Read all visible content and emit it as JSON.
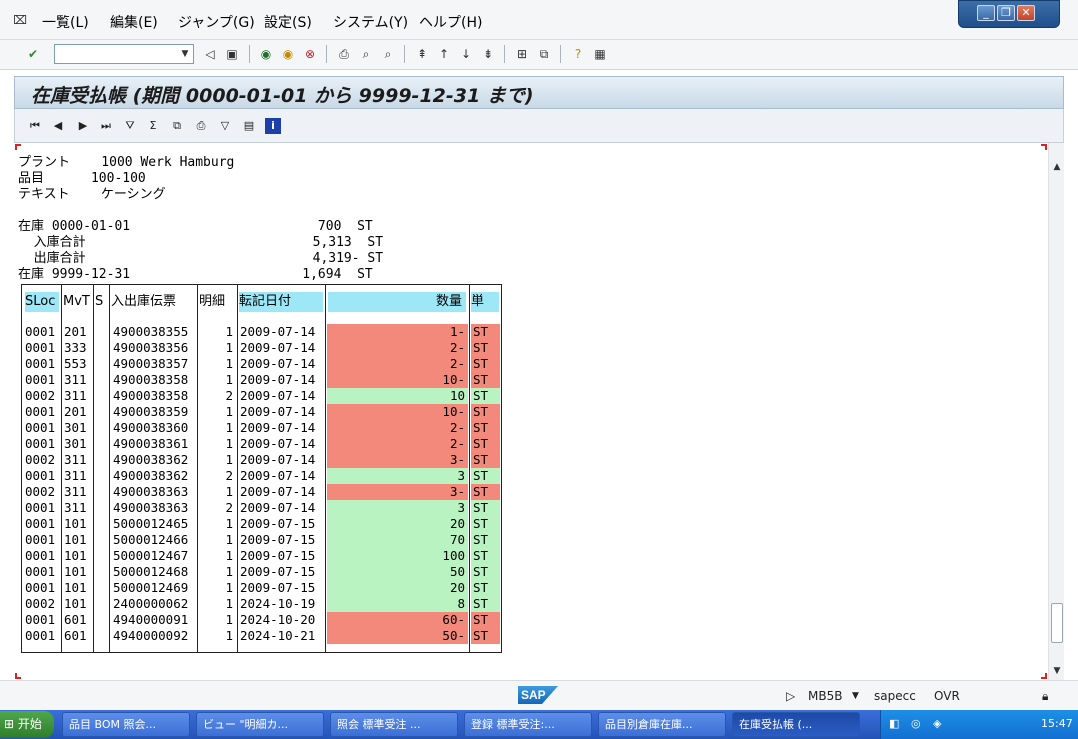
{
  "menubar": {
    "items": [
      "一覧(L)",
      "編集(E)",
      "ジャンプ(G)",
      "設定(S)",
      "システム(Y)",
      "ヘルプ(H)"
    ],
    "window_buttons": [
      "_",
      "❐",
      "✕"
    ]
  },
  "systoolbar": {
    "command_field_value": ""
  },
  "title": "在庫受払帳 (期間 0000-01-01 から 9999-12-31 まで)",
  "header": {
    "plant_line": "プラント    1000 Werk Hamburg",
    "material_line": "品目      100-100",
    "text_line": "テキスト    ケーシング",
    "stock_start_line": "在庫 0000-01-01                        700  ST",
    "receipts_line": "  入庫合計                             5,313  ST",
    "issues_line": "  出庫合計                             4,319- ST",
    "stock_end_line": "在庫 9999-12-31                      1,694  ST"
  },
  "table": {
    "columns": [
      "SLoc",
      "MvT",
      "S",
      "入出庫伝票",
      "明細",
      "転記日付",
      "数量",
      "単"
    ],
    "rows": [
      {
        "sloc": "0001",
        "mvt": "201",
        "s": "",
        "doc": "4900038355",
        "item": "1",
        "date": "2009-07-14",
        "qty": "1-",
        "unit": "ST",
        "sign": "neg"
      },
      {
        "sloc": "0001",
        "mvt": "333",
        "s": "",
        "doc": "4900038356",
        "item": "1",
        "date": "2009-07-14",
        "qty": "2-",
        "unit": "ST",
        "sign": "neg"
      },
      {
        "sloc": "0001",
        "mvt": "553",
        "s": "",
        "doc": "4900038357",
        "item": "1",
        "date": "2009-07-14",
        "qty": "2-",
        "unit": "ST",
        "sign": "neg"
      },
      {
        "sloc": "0001",
        "mvt": "311",
        "s": "",
        "doc": "4900038358",
        "item": "1",
        "date": "2009-07-14",
        "qty": "10-",
        "unit": "ST",
        "sign": "neg"
      },
      {
        "sloc": "0002",
        "mvt": "311",
        "s": "",
        "doc": "4900038358",
        "item": "2",
        "date": "2009-07-14",
        "qty": "10",
        "unit": "ST",
        "sign": "pos"
      },
      {
        "sloc": "0001",
        "mvt": "201",
        "s": "",
        "doc": "4900038359",
        "item": "1",
        "date": "2009-07-14",
        "qty": "10-",
        "unit": "ST",
        "sign": "neg"
      },
      {
        "sloc": "0001",
        "mvt": "301",
        "s": "",
        "doc": "4900038360",
        "item": "1",
        "date": "2009-07-14",
        "qty": "2-",
        "unit": "ST",
        "sign": "neg"
      },
      {
        "sloc": "0001",
        "mvt": "301",
        "s": "",
        "doc": "4900038361",
        "item": "1",
        "date": "2009-07-14",
        "qty": "2-",
        "unit": "ST",
        "sign": "neg"
      },
      {
        "sloc": "0002",
        "mvt": "311",
        "s": "",
        "doc": "4900038362",
        "item": "1",
        "date": "2009-07-14",
        "qty": "3-",
        "unit": "ST",
        "sign": "neg"
      },
      {
        "sloc": "0001",
        "mvt": "311",
        "s": "",
        "doc": "4900038362",
        "item": "2",
        "date": "2009-07-14",
        "qty": "3",
        "unit": "ST",
        "sign": "pos"
      },
      {
        "sloc": "0002",
        "mvt": "311",
        "s": "",
        "doc": "4900038363",
        "item": "1",
        "date": "2009-07-14",
        "qty": "3-",
        "unit": "ST",
        "sign": "neg"
      },
      {
        "sloc": "0001",
        "mvt": "311",
        "s": "",
        "doc": "4900038363",
        "item": "2",
        "date": "2009-07-14",
        "qty": "3",
        "unit": "ST",
        "sign": "pos"
      },
      {
        "sloc": "0001",
        "mvt": "101",
        "s": "",
        "doc": "5000012465",
        "item": "1",
        "date": "2009-07-15",
        "qty": "20",
        "unit": "ST",
        "sign": "pos"
      },
      {
        "sloc": "0001",
        "mvt": "101",
        "s": "",
        "doc": "5000012466",
        "item": "1",
        "date": "2009-07-15",
        "qty": "70",
        "unit": "ST",
        "sign": "pos"
      },
      {
        "sloc": "0001",
        "mvt": "101",
        "s": "",
        "doc": "5000012467",
        "item": "1",
        "date": "2009-07-15",
        "qty": "100",
        "unit": "ST",
        "sign": "pos"
      },
      {
        "sloc": "0001",
        "mvt": "101",
        "s": "",
        "doc": "5000012468",
        "item": "1",
        "date": "2009-07-15",
        "qty": "50",
        "unit": "ST",
        "sign": "pos"
      },
      {
        "sloc": "0001",
        "mvt": "101",
        "s": "",
        "doc": "5000012469",
        "item": "1",
        "date": "2009-07-15",
        "qty": "20",
        "unit": "ST",
        "sign": "pos"
      },
      {
        "sloc": "0002",
        "mvt": "101",
        "s": "",
        "doc": "2400000062",
        "item": "1",
        "date": "2024-10-19",
        "qty": "8",
        "unit": "ST",
        "sign": "pos"
      },
      {
        "sloc": "0001",
        "mvt": "601",
        "s": "",
        "doc": "4940000091",
        "item": "1",
        "date": "2024-10-20",
        "qty": "60-",
        "unit": "ST",
        "sign": "neg"
      },
      {
        "sloc": "0001",
        "mvt": "601",
        "s": "",
        "doc": "4940000092",
        "item": "1",
        "date": "2024-10-21",
        "qty": "50-",
        "unit": "ST",
        "sign": "neg"
      }
    ]
  },
  "status": {
    "transaction": "MB5B",
    "server": "sapecc",
    "mode": "OVR"
  },
  "taskbar": {
    "start_label": "开始",
    "tasks": [
      "品目 BOM 照会...",
      "ビュー \"明細カ...",
      "照会 標準受注 ...",
      "登録 標準受注:...",
      "品目別倉庫在庫...",
      "在庫受払帳 (..."
    ],
    "clock": "15:47"
  },
  "colors": {
    "header_cell": "#9ee7f7",
    "negative_row": "#f2897a",
    "positive_row": "#b9f3c1"
  }
}
